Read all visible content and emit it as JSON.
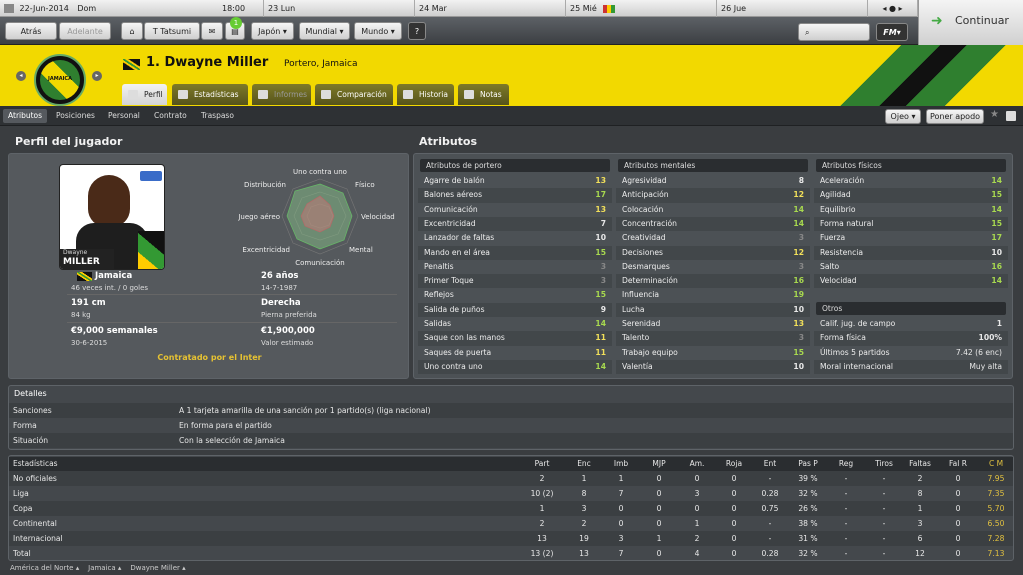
{
  "calendar": {
    "date": "22-Jun-2014",
    "day_label": "Dom",
    "time": "18:00",
    "days": [
      "23 Lun",
      "24 Mar",
      "25 Mié",
      "26 Jue"
    ]
  },
  "nav": {
    "back": "Atrás",
    "forward": "Adelante",
    "team": "T Tatsumi",
    "badge": "1",
    "menus": [
      "Japón",
      "Mundial",
      "Mundo"
    ],
    "help": "?",
    "continue": "Continuar",
    "fm_label": "FM"
  },
  "player": {
    "name": "1. Dwayne Miller",
    "subtitle": "Portero, Jamaica",
    "photo_first": "Dwayne",
    "photo_last": "MILLER",
    "club_crest": "JAMAICA"
  },
  "tabs": [
    "Perfil",
    "Estadísticas",
    "Informes",
    "Comparación",
    "Historia",
    "Notas"
  ],
  "subtabs": [
    "Atributos",
    "Posiciones",
    "Personal",
    "Contrato",
    "Traspaso"
  ],
  "actions": {
    "scout": "Ojeo",
    "nickname": "Poner apodo"
  },
  "profile": {
    "title": "Perfil del jugador",
    "nationality": "Jamaica",
    "caps": "46 veces int. / 0 goles",
    "age": "26 años",
    "dob": "14-7-1987",
    "height": "191 cm",
    "weight": "84 kg",
    "foot": "Derecha",
    "foot_label": "Pierna preferida",
    "wage": "€9,000 semanales",
    "contract_end": "30-6-2015",
    "value": "€1,900,000",
    "value_label": "Valor estimado",
    "status": "Contratado por el Inter",
    "radar_labels": [
      "Uno contra uno",
      "Físico",
      "Velocidad",
      "Mental",
      "Comunicación",
      "Excentricidad",
      "Juego aéreo",
      "Distribución"
    ]
  },
  "attributes": {
    "title": "Atributos",
    "gk_title": "Atributos de portero",
    "goalkeeping": [
      [
        "Agarre de balón",
        "13"
      ],
      [
        "Balones aéreos",
        "17"
      ],
      [
        "Comunicación",
        "13"
      ],
      [
        "Excentricidad",
        "7"
      ],
      [
        "Lanzador de faltas",
        "10"
      ],
      [
        "Mando en el área",
        "15"
      ],
      [
        "Penaltis",
        "3"
      ],
      [
        "Primer Toque",
        "3"
      ],
      [
        "Reflejos",
        "15"
      ],
      [
        "Salida de puños",
        "9"
      ],
      [
        "Salidas",
        "14"
      ],
      [
        "Saque con las manos",
        "11"
      ],
      [
        "Saques de puerta",
        "11"
      ],
      [
        "Uno contra uno",
        "14"
      ]
    ],
    "mental_title": "Atributos mentales",
    "mental": [
      [
        "Agresividad",
        "8"
      ],
      [
        "Anticipación",
        "12"
      ],
      [
        "Colocación",
        "14"
      ],
      [
        "Concentración",
        "14"
      ],
      [
        "Creatividad",
        "3"
      ],
      [
        "Decisiones",
        "12"
      ],
      [
        "Desmarques",
        "3"
      ],
      [
        "Determinación",
        "16"
      ],
      [
        "Influencia",
        "19"
      ],
      [
        "Lucha",
        "10"
      ],
      [
        "Serenidad",
        "13"
      ],
      [
        "Talento",
        "3"
      ],
      [
        "Trabajo equipo",
        "15"
      ],
      [
        "Valentía",
        "10"
      ]
    ],
    "physical_title": "Atributos físicos",
    "physical": [
      [
        "Aceleración",
        "14"
      ],
      [
        "Agilidad",
        "15"
      ],
      [
        "Equilibrio",
        "14"
      ],
      [
        "Forma natural",
        "15"
      ],
      [
        "Fuerza",
        "17"
      ],
      [
        "Resistencia",
        "10"
      ],
      [
        "Salto",
        "16"
      ],
      [
        "Velocidad",
        "14"
      ]
    ],
    "other_title": "Otros",
    "other": [
      [
        "Calif. jug. de campo",
        "1"
      ],
      [
        "Forma física",
        "100%"
      ],
      [
        "Últimos 5 partidos",
        "7.42 (6 enc)"
      ],
      [
        "Moral internacional",
        "Muy alta"
      ]
    ]
  },
  "details": {
    "title": "Detalles",
    "rows": [
      [
        "Sanciones",
        "A 1 tarjeta amarilla de una sanción por 1 partido(s) (liga nacional)"
      ],
      [
        "Forma",
        "En forma para el partido"
      ],
      [
        "Situación",
        "Con la selección de Jamaica"
      ]
    ]
  },
  "stats": {
    "title": "Estadísticas",
    "columns": [
      "Part",
      "Enc",
      "Imb",
      "MJP",
      "Am.",
      "Roja",
      "Ent",
      "Pas P",
      "Reg",
      "Tiros",
      "Faltas",
      "Fal R",
      "C M"
    ],
    "rows": [
      [
        "No oficiales",
        "2",
        "1",
        "1",
        "0",
        "0",
        "0",
        "-",
        "39 %",
        "-",
        "-",
        "2",
        "0",
        "7.95"
      ],
      [
        "Liga",
        "10 (2)",
        "8",
        "7",
        "0",
        "3",
        "0",
        "0.28",
        "32 %",
        "-",
        "-",
        "8",
        "0",
        "7.35"
      ],
      [
        "Copa",
        "1",
        "3",
        "0",
        "0",
        "0",
        "0",
        "0.75",
        "26 %",
        "-",
        "-",
        "1",
        "0",
        "5.70"
      ],
      [
        "Continental",
        "2",
        "2",
        "0",
        "0",
        "1",
        "0",
        "-",
        "38 %",
        "-",
        "-",
        "3",
        "0",
        "6.50"
      ],
      [
        "Internacional",
        "13",
        "19",
        "3",
        "1",
        "2",
        "0",
        "-",
        "31 %",
        "-",
        "-",
        "6",
        "0",
        "7.28"
      ],
      [
        "Total",
        "13 (2)",
        "13",
        "7",
        "0",
        "4",
        "0",
        "0.28",
        "32 %",
        "-",
        "-",
        "12",
        "0",
        "7.13"
      ]
    ]
  },
  "breadcrumb": [
    "América del Norte",
    "Jamaica",
    "Dwayne Miller"
  ],
  "colors": {
    "header_yellow": "#f2d900",
    "good": "#a8d94f",
    "mid": "#f2e05a",
    "rating": "#e0c040"
  }
}
